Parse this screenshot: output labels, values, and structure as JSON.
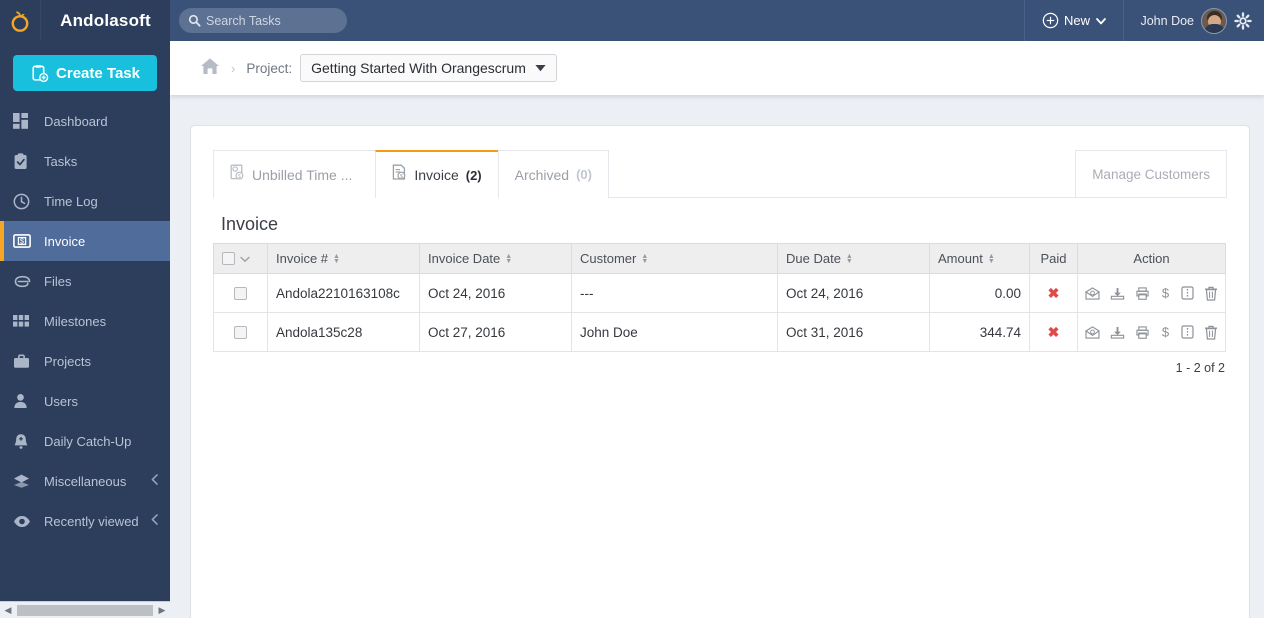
{
  "topbar": {
    "brand": "Andolasoft",
    "logo_icon": "orange-fruit-logo",
    "search": {
      "placeholder": "Search Tasks",
      "value": "",
      "icon": "search-icon"
    },
    "new_button": {
      "label": "New",
      "plus_icon": "plus-circle-icon",
      "caret_icon": "chevron-down-icon"
    },
    "user": {
      "name": "John Doe",
      "avatar_icon": "user-avatar"
    },
    "settings_icon": "gear-icon"
  },
  "sidebar": {
    "create_task": {
      "label": "Create Task",
      "icon": "add-task-icon"
    },
    "items": [
      {
        "label": "Dashboard",
        "icon": "dashboard-icon",
        "active": false,
        "chevron": false
      },
      {
        "label": "Tasks",
        "icon": "tasks-icon",
        "active": false,
        "chevron": false
      },
      {
        "label": "Time Log",
        "icon": "clock-icon",
        "active": false,
        "chevron": false
      },
      {
        "label": "Invoice",
        "icon": "invoice-icon",
        "active": true,
        "chevron": false
      },
      {
        "label": "Files",
        "icon": "paperclip-icon",
        "active": false,
        "chevron": false
      },
      {
        "label": "Milestones",
        "icon": "grid-icon",
        "active": false,
        "chevron": false
      },
      {
        "label": "Projects",
        "icon": "briefcase-icon",
        "active": false,
        "chevron": false
      },
      {
        "label": "Users",
        "icon": "user-icon",
        "active": false,
        "chevron": false
      },
      {
        "label": "Daily Catch-Up",
        "icon": "bell-icon",
        "active": false,
        "chevron": false
      },
      {
        "label": "Miscellaneous",
        "icon": "layers-icon",
        "active": false,
        "chevron": true
      },
      {
        "label": "Recently viewed",
        "icon": "eye-icon",
        "active": false,
        "chevron": true
      }
    ],
    "scrollbar": {
      "left_arrow": "◀",
      "right_arrow": "▶"
    }
  },
  "breadcrumb": {
    "home_icon": "home-icon",
    "separator": "›",
    "project_label": "Project:",
    "project_value": "Getting Started With Orangescrum",
    "caret_icon": "caret-down-icon"
  },
  "tabs": [
    {
      "label": "Unbilled Time ...",
      "count": "",
      "active": false,
      "icon": "unbilled-time-icon"
    },
    {
      "label": "Invoice",
      "count": "(2)",
      "active": true,
      "icon": "invoice-doc-icon"
    },
    {
      "label": "Archived",
      "count": "(0)",
      "active": false,
      "icon": ""
    }
  ],
  "manage_customers": {
    "label": "Manage Customers"
  },
  "section": {
    "title": "Invoice"
  },
  "table": {
    "select_all": {
      "checkbox": "",
      "caret_icon": "chevron-down-icon"
    },
    "columns": [
      {
        "key": "select",
        "label": "",
        "sortable": false
      },
      {
        "key": "number",
        "label": "Invoice #",
        "sortable": true
      },
      {
        "key": "inv_date",
        "label": "Invoice Date",
        "sortable": true
      },
      {
        "key": "customer",
        "label": "Customer",
        "sortable": true
      },
      {
        "key": "due_date",
        "label": "Due Date",
        "sortable": true
      },
      {
        "key": "amount",
        "label": "Amount",
        "sortable": true
      },
      {
        "key": "paid",
        "label": "Paid",
        "sortable": false
      },
      {
        "key": "action",
        "label": "Action",
        "sortable": false
      }
    ],
    "rows": [
      {
        "number": "Andola2210163108c",
        "inv_date": "Oct 24, 2016",
        "customer": "---",
        "due_date": "Oct 24, 2016",
        "amount": "0.00",
        "paid": "✖",
        "paid_state": "unpaid"
      },
      {
        "number": "Andola135c28",
        "inv_date": "Oct 27, 2016",
        "customer": "John Doe",
        "due_date": "Oct 31, 2016",
        "amount": "344.74",
        "paid": "✖",
        "paid_state": "unpaid"
      }
    ],
    "row_actions": [
      {
        "name": "email-icon",
        "title": "Email"
      },
      {
        "name": "download-icon",
        "title": "Download"
      },
      {
        "name": "print-icon",
        "title": "Print"
      },
      {
        "name": "dollar-icon",
        "title": "Payment"
      },
      {
        "name": "archive-icon",
        "title": "Archive"
      },
      {
        "name": "trash-icon",
        "title": "Delete"
      }
    ],
    "pagination": "1 - 2 of 2"
  },
  "colors": {
    "topbar_bg": "#3b5278",
    "sidebar_bg": "#2c3e5c",
    "sidebar_active_bg": "#4f6c9b",
    "accent_orange": "#f5a623",
    "create_task_cyan": "#19c0dd",
    "page_bg": "#eceff3",
    "paid_red": "#e04a4a"
  }
}
